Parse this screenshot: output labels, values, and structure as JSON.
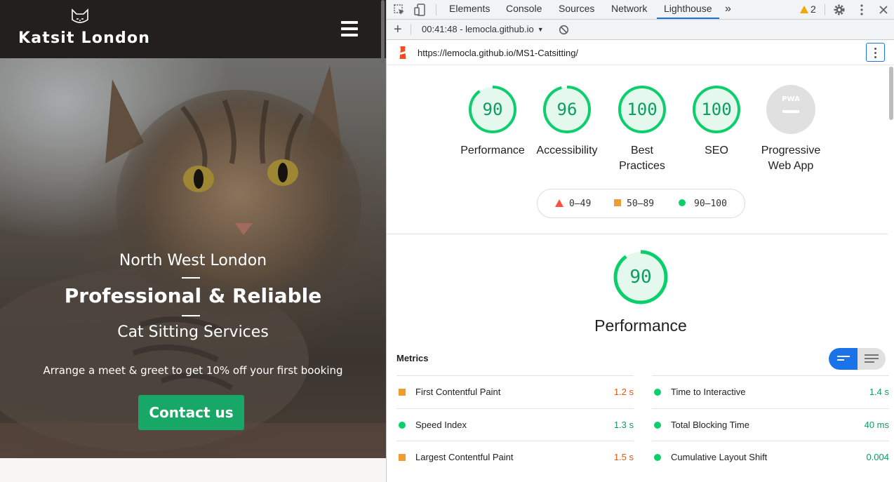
{
  "website": {
    "title": "Katsit London",
    "hero": {
      "line1": "North West London",
      "line2": "Professional & Reliable",
      "line3": "Cat Sitting Services",
      "tagline": "Arrange a meet & greet to get 10% off your first booking",
      "cta": "Contact us"
    }
  },
  "devtools": {
    "tabs": [
      "Elements",
      "Console",
      "Sources",
      "Network",
      "Lighthouse"
    ],
    "active_tab": "Lighthouse",
    "warning_count": "2",
    "report_selector": "00:41:48 - lemocla.github.io",
    "url": "https://lemocla.github.io/MS1-Catsitting/",
    "categories": [
      {
        "label": "Performance",
        "score": "90",
        "fraction": 0.9
      },
      {
        "label": "Accessibility",
        "score": "96",
        "fraction": 0.96
      },
      {
        "label": "Best Practices",
        "score": "100",
        "fraction": 1.0
      },
      {
        "label": "SEO",
        "score": "100",
        "fraction": 1.0
      },
      {
        "label": "Progressive Web App",
        "badge": "PWA"
      }
    ],
    "legend": {
      "fail": "0–49",
      "average": "50–89",
      "pass": "90–100"
    },
    "performance": {
      "score": "90",
      "fraction": 0.9,
      "title": "Performance",
      "metrics_heading": "Metrics",
      "metrics": [
        {
          "name": "First Contentful Paint",
          "value": "1.2 s",
          "status": "average"
        },
        {
          "name": "Time to Interactive",
          "value": "1.4 s",
          "status": "pass"
        },
        {
          "name": "Speed Index",
          "value": "1.3 s",
          "status": "pass"
        },
        {
          "name": "Total Blocking Time",
          "value": "40 ms",
          "status": "pass"
        },
        {
          "name": "Largest Contentful Paint",
          "value": "1.5 s",
          "status": "average"
        },
        {
          "name": "Cumulative Layout Shift",
          "value": "0.004",
          "status": "pass"
        }
      ]
    },
    "colors": {
      "pass": "#0cce6b",
      "average": "#f09c34",
      "fail": "#ff4e42",
      "accent": "#1a73e8"
    }
  }
}
